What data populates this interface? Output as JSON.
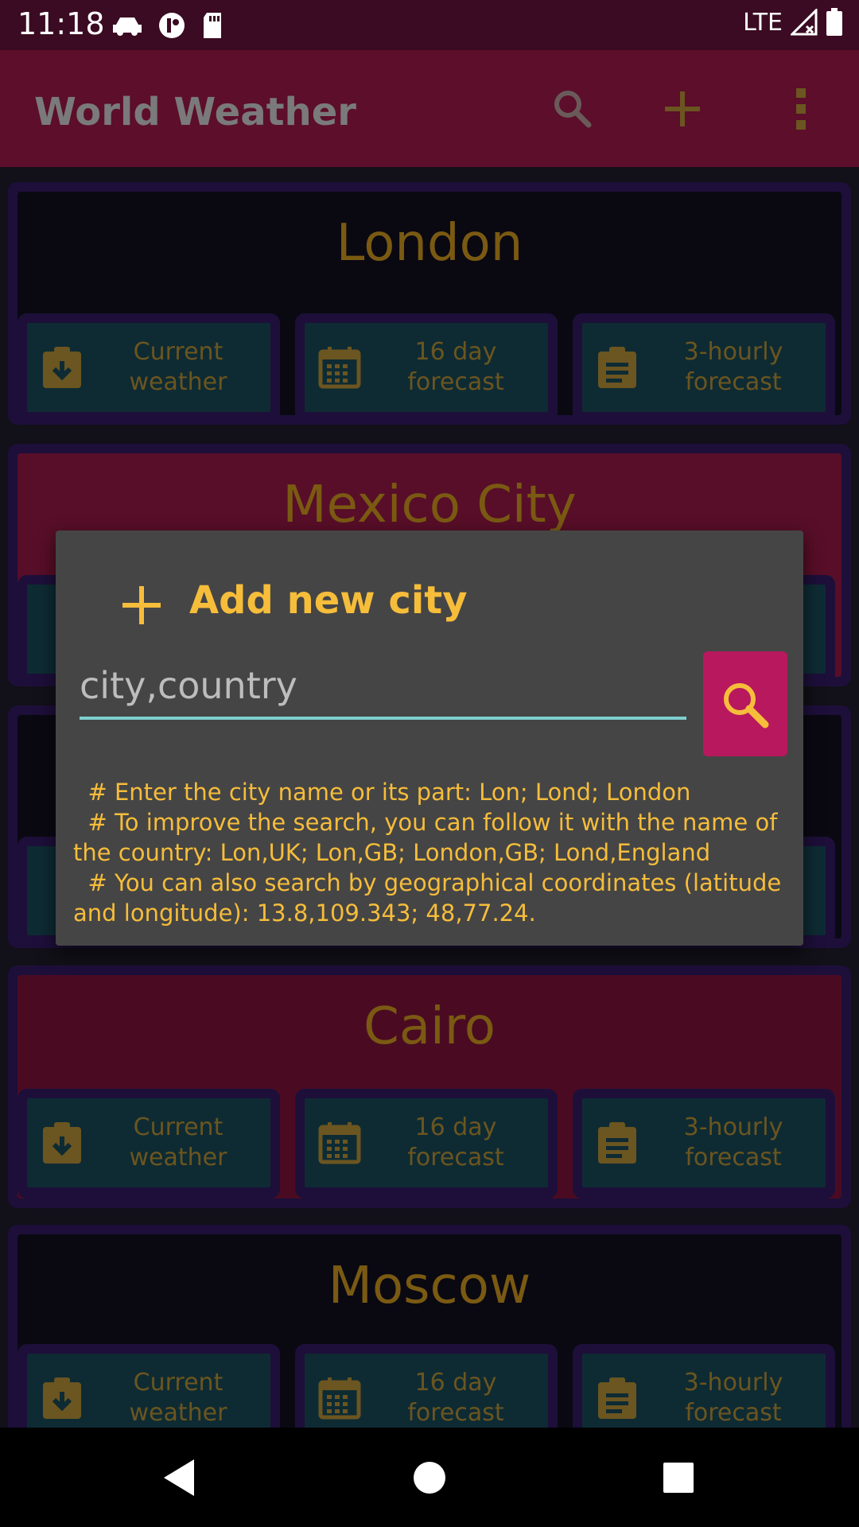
{
  "status_bar": {
    "time": "11:18",
    "network": "LTE"
  },
  "app_bar": {
    "title": "World Weather",
    "icons": [
      "search-icon",
      "plus-icon",
      "overflow-menu-icon"
    ]
  },
  "cities": [
    {
      "name": "London",
      "bg": "#0a0912"
    },
    {
      "name": "Mexico City",
      "bg": "#580e28"
    },
    {
      "name": "",
      "bg": "#0a0912"
    },
    {
      "name": "Cairo",
      "bg": "#4a0b22"
    },
    {
      "name": "Moscow",
      "bg": "#0a0912"
    }
  ],
  "actions": {
    "current": "Current weather",
    "forecast16": "16 day forecast",
    "hourly": "3-hourly forecast"
  },
  "dialog": {
    "title": "Add new city",
    "input_placeholder": "city,country",
    "input_value": "",
    "help": [
      "  # Enter the city name or its part: Lon; Lond; London",
      "  # To improve the search, you can follow it with the name of the country: Lon,UK; Lon,GB; London,GB; Lond,England",
      "  # You can also search by geographical coordinates (latitude and longitude): 13.8,109.343; 48,77.24."
    ]
  },
  "colors": {
    "accent": "#f6bd3b",
    "search_button": "#b8185d",
    "app_bar": "#5c0e2a",
    "input_underline": "#7fcfcf"
  }
}
